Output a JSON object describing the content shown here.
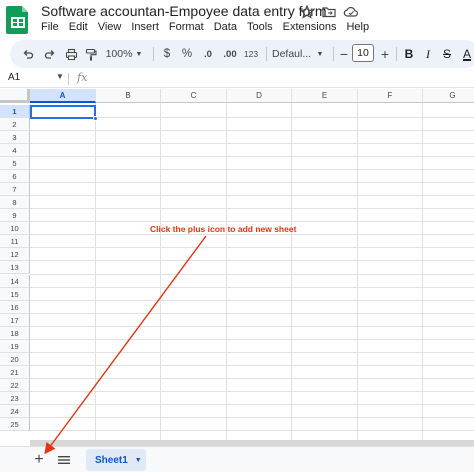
{
  "app": {
    "doc_title": "Software accountan-Empoyee data entry form",
    "brand_color": "#0f9d58",
    "title_icons": [
      "star-icon",
      "move-to-folder-icon",
      "cloud-status-icon"
    ]
  },
  "menu": [
    "File",
    "Edit",
    "View",
    "Insert",
    "Format",
    "Data",
    "Tools",
    "Extensions",
    "Help"
  ],
  "toolbar": {
    "zoom": "100%",
    "currency": "$",
    "percent": "%",
    "decrease_decimal": ".0",
    "increase_decimal": ".00",
    "number_format": "123",
    "font": "Defaul...",
    "font_size": "10",
    "decrease_font": "−",
    "increase_font": "+",
    "bold": "B",
    "italic": "I",
    "strikethrough": "S",
    "text_color": "A"
  },
  "formula_bar": {
    "name_box": "A1",
    "fx": "fx"
  },
  "grid": {
    "columns": [
      "A",
      "B",
      "C",
      "D",
      "E",
      "F",
      "G"
    ],
    "rows": [
      "1",
      "2",
      "3",
      "4",
      "5",
      "6",
      "7",
      "8",
      "9",
      "10",
      "11",
      "12",
      "13",
      "14",
      "15",
      "16",
      "17",
      "18",
      "19",
      "20",
      "21",
      "22",
      "23",
      "24",
      "25"
    ],
    "selected_cell": "A1",
    "accent_color": "#1a73e8"
  },
  "annotation": {
    "text": "Click the plus icon to add new sheet",
    "color": "#e8340c"
  },
  "sheets": {
    "add_label": "+",
    "tabs": [
      {
        "name": "Sheet1"
      }
    ]
  }
}
